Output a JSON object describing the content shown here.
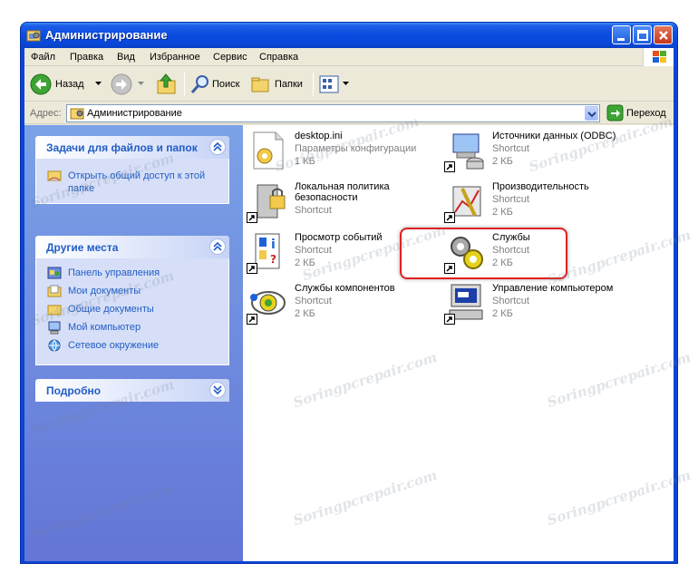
{
  "window": {
    "title": "Администрирование"
  },
  "menu": [
    "Файл",
    "Правка",
    "Вид",
    "Избранное",
    "Сервис",
    "Справка"
  ],
  "toolbar": {
    "back": "Назад",
    "search": "Поиск",
    "folders": "Папки"
  },
  "address": {
    "label": "Адрес:",
    "value": "Администрирование",
    "go": "Переход"
  },
  "panels": [
    {
      "title": "Задачи для файлов и папок",
      "items": [
        {
          "label": "Открыть общий доступ к этой папке",
          "icon": "share-folder-icon"
        }
      ]
    },
    {
      "title": "Другие места",
      "items": [
        {
          "label": "Панель управления",
          "icon": "control-panel-icon"
        },
        {
          "label": "Мои документы",
          "icon": "my-documents-icon"
        },
        {
          "label": "Общие документы",
          "icon": "shared-documents-icon"
        },
        {
          "label": "Мой компьютер",
          "icon": "my-computer-icon"
        },
        {
          "label": "Сетевое окружение",
          "icon": "network-icon"
        }
      ]
    },
    {
      "title": "Подробно",
      "items": []
    }
  ],
  "files": [
    {
      "name": "desktop.ini",
      "line2": "Параметры конфигурации",
      "line3": "1 КБ",
      "icon": "ini-file-icon"
    },
    {
      "name": "Источники данных (ODBC)",
      "line2": "Shortcut",
      "line3": "2 КБ",
      "icon": "odbc-icon"
    },
    {
      "name": "Локальная политика",
      "name2": "безопасности",
      "line2": "Shortcut",
      "icon": "security-policy-icon"
    },
    {
      "name": "Производительность",
      "line2": "Shortcut",
      "line3": "2 КБ",
      "icon": "performance-icon"
    },
    {
      "name": "Просмотр событий",
      "line2": "Shortcut",
      "line3": "2 КБ",
      "icon": "event-viewer-icon"
    },
    {
      "name": "Службы",
      "line2": "Shortcut",
      "line3": "2 КБ",
      "icon": "services-icon"
    },
    {
      "name": "Службы компонентов",
      "line2": "Shortcut",
      "line3": "2 КБ",
      "icon": "component-services-icon"
    },
    {
      "name": "Управление компьютером",
      "line2": "Shortcut",
      "line3": "2 КБ",
      "icon": "computer-management-icon"
    }
  ],
  "watermark": "Soringpcrepair.com"
}
